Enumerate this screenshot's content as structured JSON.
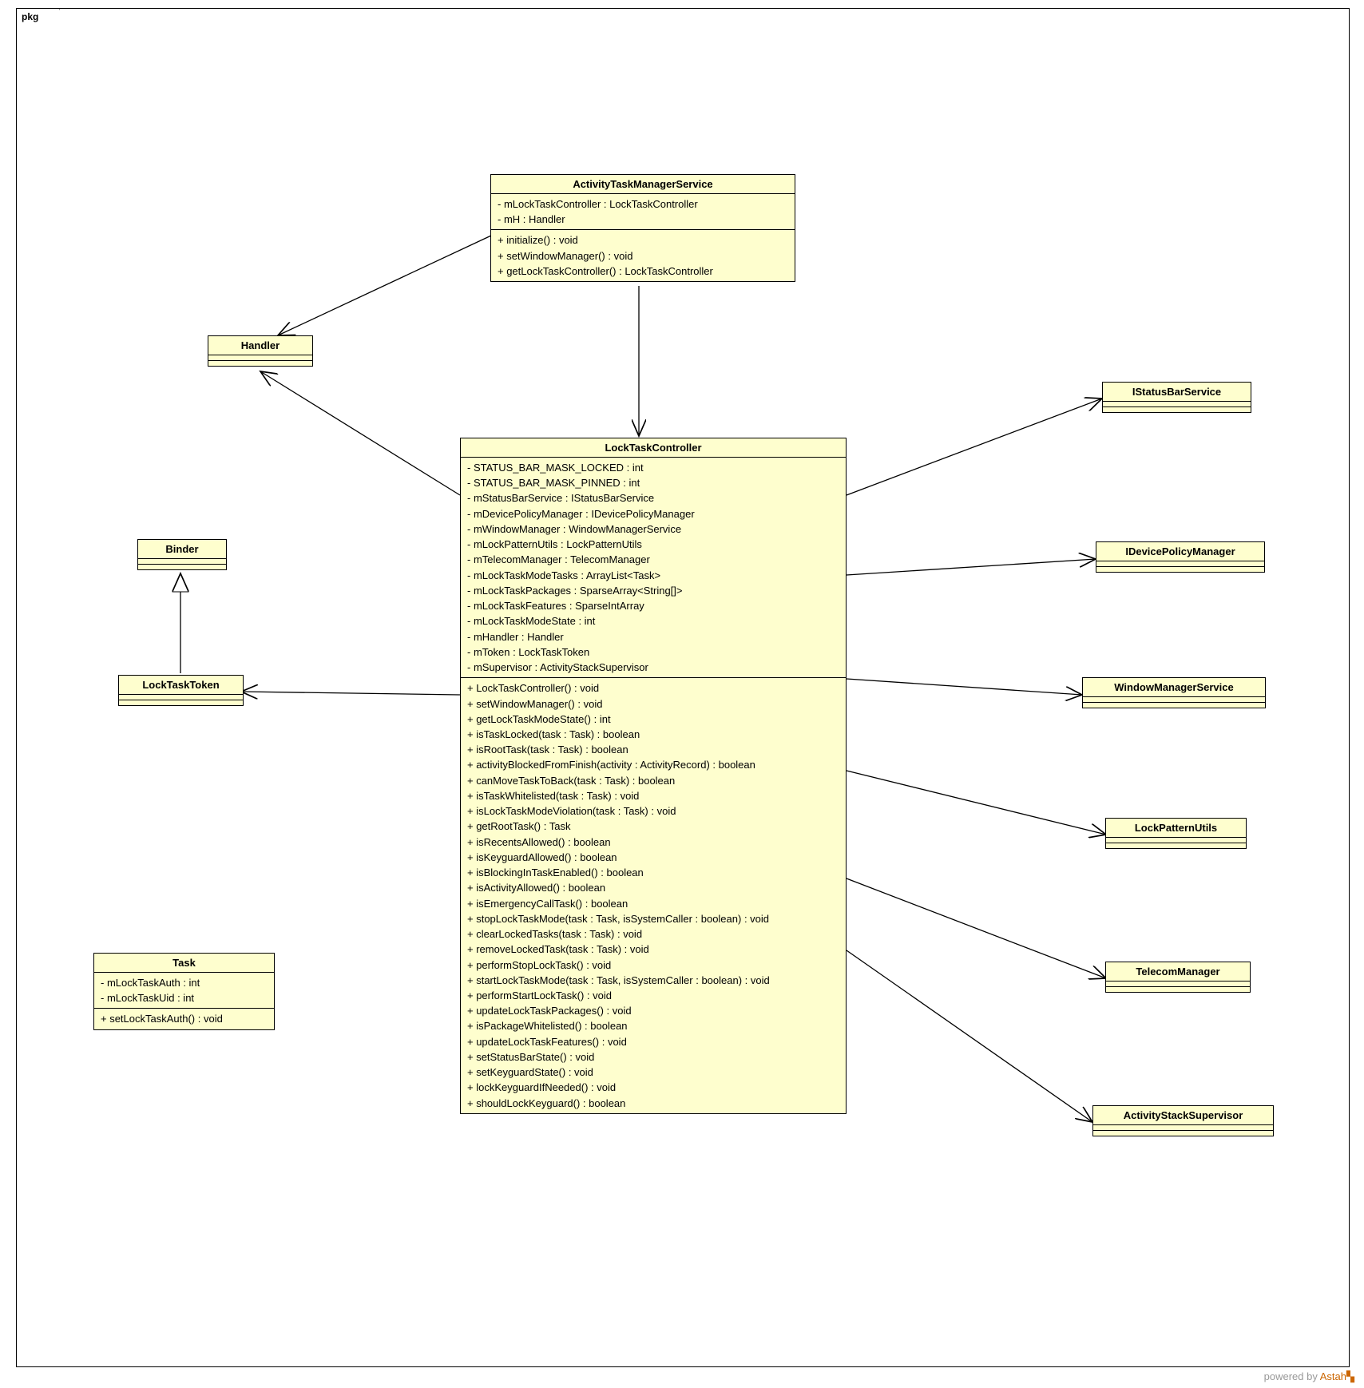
{
  "package_label": "pkg",
  "watermark": {
    "text": "powered by ",
    "brand": "Astah"
  },
  "classes": {
    "atms": {
      "name": "ActivityTaskManagerService",
      "attrs": [
        "- mLockTaskController : LockTaskController",
        "- mH : Handler"
      ],
      "ops": [
        "+ initialize() : void",
        "+ setWindowManager() : void",
        "+ getLockTaskController() : LockTaskController"
      ]
    },
    "handler": {
      "name": "Handler"
    },
    "binder": {
      "name": "Binder"
    },
    "locktasktoken": {
      "name": "LockTaskToken"
    },
    "task": {
      "name": "Task",
      "attrs": [
        "- mLockTaskAuth : int",
        "- mLockTaskUid : int"
      ],
      "ops": [
        "+ setLockTaskAuth() : void"
      ]
    },
    "ltc": {
      "name": "LockTaskController",
      "attrs": [
        "- STATUS_BAR_MASK_LOCKED : int",
        "- STATUS_BAR_MASK_PINNED : int",
        "- mStatusBarService : IStatusBarService",
        "- mDevicePolicyManager : IDevicePolicyManager",
        "- mWindowManager : WindowManagerService",
        "- mLockPatternUtils : LockPatternUtils",
        "- mTelecomManager : TelecomManager",
        "- mLockTaskModeTasks : ArrayList<Task>",
        "- mLockTaskPackages : SparseArray<String[]>",
        "- mLockTaskFeatures : SparseIntArray",
        "- mLockTaskModeState : int",
        "- mHandler : Handler",
        "- mToken : LockTaskToken",
        "- mSupervisor : ActivityStackSupervisor"
      ],
      "ops": [
        "+ LockTaskController() : void",
        "+ setWindowManager() : void",
        "+ getLockTaskModeState() : int",
        "+ isTaskLocked(task : Task) : boolean",
        "+ isRootTask(task : Task) : boolean",
        "+ activityBlockedFromFinish(activity : ActivityRecord) : boolean",
        "+ canMoveTaskToBack(task : Task) : boolean",
        "+ isTaskWhitelisted(task : Task) : void",
        "+ isLockTaskModeViolation(task : Task) : void",
        "+ getRootTask() : Task",
        "+ isRecentsAllowed() : boolean",
        "+ isKeyguardAllowed() : boolean",
        "+ isBlockingInTaskEnabled() : boolean",
        "+ isActivityAllowed() : boolean",
        "+ isEmergencyCallTask() : boolean",
        "+ stopLockTaskMode(task : Task, isSystemCaller : boolean) : void",
        "+ clearLockedTasks(task : Task) : void",
        "+ removeLockedTask(task : Task) : void",
        "+ performStopLockTask() : void",
        "+ startLockTaskMode(task : Task, isSystemCaller : boolean) : void",
        "+ performStartLockTask() : void",
        "+ updateLockTaskPackages() : void",
        "+ isPackageWhitelisted() : boolean",
        "+ updateLockTaskFeatures() : void",
        "+ setStatusBarState() : void",
        "+ setKeyguardState() : void",
        "+ lockKeyguardIfNeeded() : void",
        "+ shouldLockKeyguard() : boolean"
      ]
    },
    "isbs": {
      "name": "IStatusBarService"
    },
    "idpm": {
      "name": "IDevicePolicyManager"
    },
    "wms": {
      "name": "WindowManagerService"
    },
    "lpu": {
      "name": "LockPatternUtils"
    },
    "tm": {
      "name": "TelecomManager"
    },
    "ass": {
      "name": "ActivityStackSupervisor"
    }
  }
}
